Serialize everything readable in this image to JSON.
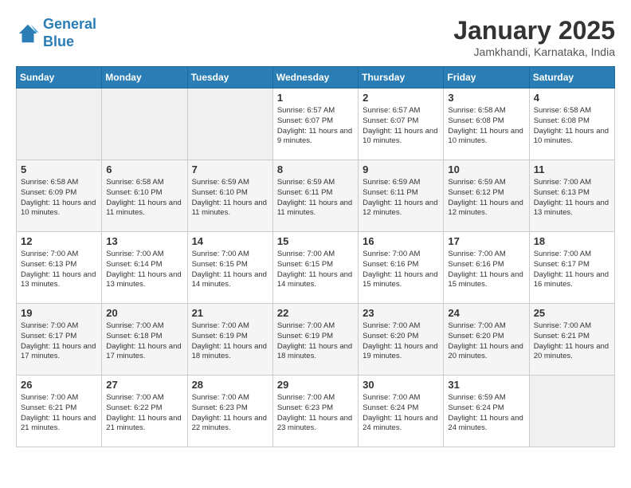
{
  "app": {
    "logo_line1": "General",
    "logo_line2": "Blue"
  },
  "header": {
    "month": "January 2025",
    "location": "Jamkhandi, Karnataka, India"
  },
  "days_of_week": [
    "Sunday",
    "Monday",
    "Tuesday",
    "Wednesday",
    "Thursday",
    "Friday",
    "Saturday"
  ],
  "weeks": [
    [
      {
        "day": "",
        "empty": true
      },
      {
        "day": "",
        "empty": true
      },
      {
        "day": "",
        "empty": true
      },
      {
        "day": "1",
        "sunrise": "Sunrise: 6:57 AM",
        "sunset": "Sunset: 6:07 PM",
        "daylight": "Daylight: 11 hours and 9 minutes."
      },
      {
        "day": "2",
        "sunrise": "Sunrise: 6:57 AM",
        "sunset": "Sunset: 6:07 PM",
        "daylight": "Daylight: 11 hours and 10 minutes."
      },
      {
        "day": "3",
        "sunrise": "Sunrise: 6:58 AM",
        "sunset": "Sunset: 6:08 PM",
        "daylight": "Daylight: 11 hours and 10 minutes."
      },
      {
        "day": "4",
        "sunrise": "Sunrise: 6:58 AM",
        "sunset": "Sunset: 6:08 PM",
        "daylight": "Daylight: 11 hours and 10 minutes."
      }
    ],
    [
      {
        "day": "5",
        "sunrise": "Sunrise: 6:58 AM",
        "sunset": "Sunset: 6:09 PM",
        "daylight": "Daylight: 11 hours and 10 minutes."
      },
      {
        "day": "6",
        "sunrise": "Sunrise: 6:58 AM",
        "sunset": "Sunset: 6:10 PM",
        "daylight": "Daylight: 11 hours and 11 minutes."
      },
      {
        "day": "7",
        "sunrise": "Sunrise: 6:59 AM",
        "sunset": "Sunset: 6:10 PM",
        "daylight": "Daylight: 11 hours and 11 minutes."
      },
      {
        "day": "8",
        "sunrise": "Sunrise: 6:59 AM",
        "sunset": "Sunset: 6:11 PM",
        "daylight": "Daylight: 11 hours and 11 minutes."
      },
      {
        "day": "9",
        "sunrise": "Sunrise: 6:59 AM",
        "sunset": "Sunset: 6:11 PM",
        "daylight": "Daylight: 11 hours and 12 minutes."
      },
      {
        "day": "10",
        "sunrise": "Sunrise: 6:59 AM",
        "sunset": "Sunset: 6:12 PM",
        "daylight": "Daylight: 11 hours and 12 minutes."
      },
      {
        "day": "11",
        "sunrise": "Sunrise: 7:00 AM",
        "sunset": "Sunset: 6:13 PM",
        "daylight": "Daylight: 11 hours and 13 minutes."
      }
    ],
    [
      {
        "day": "12",
        "sunrise": "Sunrise: 7:00 AM",
        "sunset": "Sunset: 6:13 PM",
        "daylight": "Daylight: 11 hours and 13 minutes."
      },
      {
        "day": "13",
        "sunrise": "Sunrise: 7:00 AM",
        "sunset": "Sunset: 6:14 PM",
        "daylight": "Daylight: 11 hours and 13 minutes."
      },
      {
        "day": "14",
        "sunrise": "Sunrise: 7:00 AM",
        "sunset": "Sunset: 6:15 PM",
        "daylight": "Daylight: 11 hours and 14 minutes."
      },
      {
        "day": "15",
        "sunrise": "Sunrise: 7:00 AM",
        "sunset": "Sunset: 6:15 PM",
        "daylight": "Daylight: 11 hours and 14 minutes."
      },
      {
        "day": "16",
        "sunrise": "Sunrise: 7:00 AM",
        "sunset": "Sunset: 6:16 PM",
        "daylight": "Daylight: 11 hours and 15 minutes."
      },
      {
        "day": "17",
        "sunrise": "Sunrise: 7:00 AM",
        "sunset": "Sunset: 6:16 PM",
        "daylight": "Daylight: 11 hours and 15 minutes."
      },
      {
        "day": "18",
        "sunrise": "Sunrise: 7:00 AM",
        "sunset": "Sunset: 6:17 PM",
        "daylight": "Daylight: 11 hours and 16 minutes."
      }
    ],
    [
      {
        "day": "19",
        "sunrise": "Sunrise: 7:00 AM",
        "sunset": "Sunset: 6:17 PM",
        "daylight": "Daylight: 11 hours and 17 minutes."
      },
      {
        "day": "20",
        "sunrise": "Sunrise: 7:00 AM",
        "sunset": "Sunset: 6:18 PM",
        "daylight": "Daylight: 11 hours and 17 minutes."
      },
      {
        "day": "21",
        "sunrise": "Sunrise: 7:00 AM",
        "sunset": "Sunset: 6:19 PM",
        "daylight": "Daylight: 11 hours and 18 minutes."
      },
      {
        "day": "22",
        "sunrise": "Sunrise: 7:00 AM",
        "sunset": "Sunset: 6:19 PM",
        "daylight": "Daylight: 11 hours and 18 minutes."
      },
      {
        "day": "23",
        "sunrise": "Sunrise: 7:00 AM",
        "sunset": "Sunset: 6:20 PM",
        "daylight": "Daylight: 11 hours and 19 minutes."
      },
      {
        "day": "24",
        "sunrise": "Sunrise: 7:00 AM",
        "sunset": "Sunset: 6:20 PM",
        "daylight": "Daylight: 11 hours and 20 minutes."
      },
      {
        "day": "25",
        "sunrise": "Sunrise: 7:00 AM",
        "sunset": "Sunset: 6:21 PM",
        "daylight": "Daylight: 11 hours and 20 minutes."
      }
    ],
    [
      {
        "day": "26",
        "sunrise": "Sunrise: 7:00 AM",
        "sunset": "Sunset: 6:21 PM",
        "daylight": "Daylight: 11 hours and 21 minutes."
      },
      {
        "day": "27",
        "sunrise": "Sunrise: 7:00 AM",
        "sunset": "Sunset: 6:22 PM",
        "daylight": "Daylight: 11 hours and 21 minutes."
      },
      {
        "day": "28",
        "sunrise": "Sunrise: 7:00 AM",
        "sunset": "Sunset: 6:23 PM",
        "daylight": "Daylight: 11 hours and 22 minutes."
      },
      {
        "day": "29",
        "sunrise": "Sunrise: 7:00 AM",
        "sunset": "Sunset: 6:23 PM",
        "daylight": "Daylight: 11 hours and 23 minutes."
      },
      {
        "day": "30",
        "sunrise": "Sunrise: 7:00 AM",
        "sunset": "Sunset: 6:24 PM",
        "daylight": "Daylight: 11 hours and 24 minutes."
      },
      {
        "day": "31",
        "sunrise": "Sunrise: 6:59 AM",
        "sunset": "Sunset: 6:24 PM",
        "daylight": "Daylight: 11 hours and 24 minutes."
      },
      {
        "day": "",
        "empty": true
      }
    ]
  ]
}
